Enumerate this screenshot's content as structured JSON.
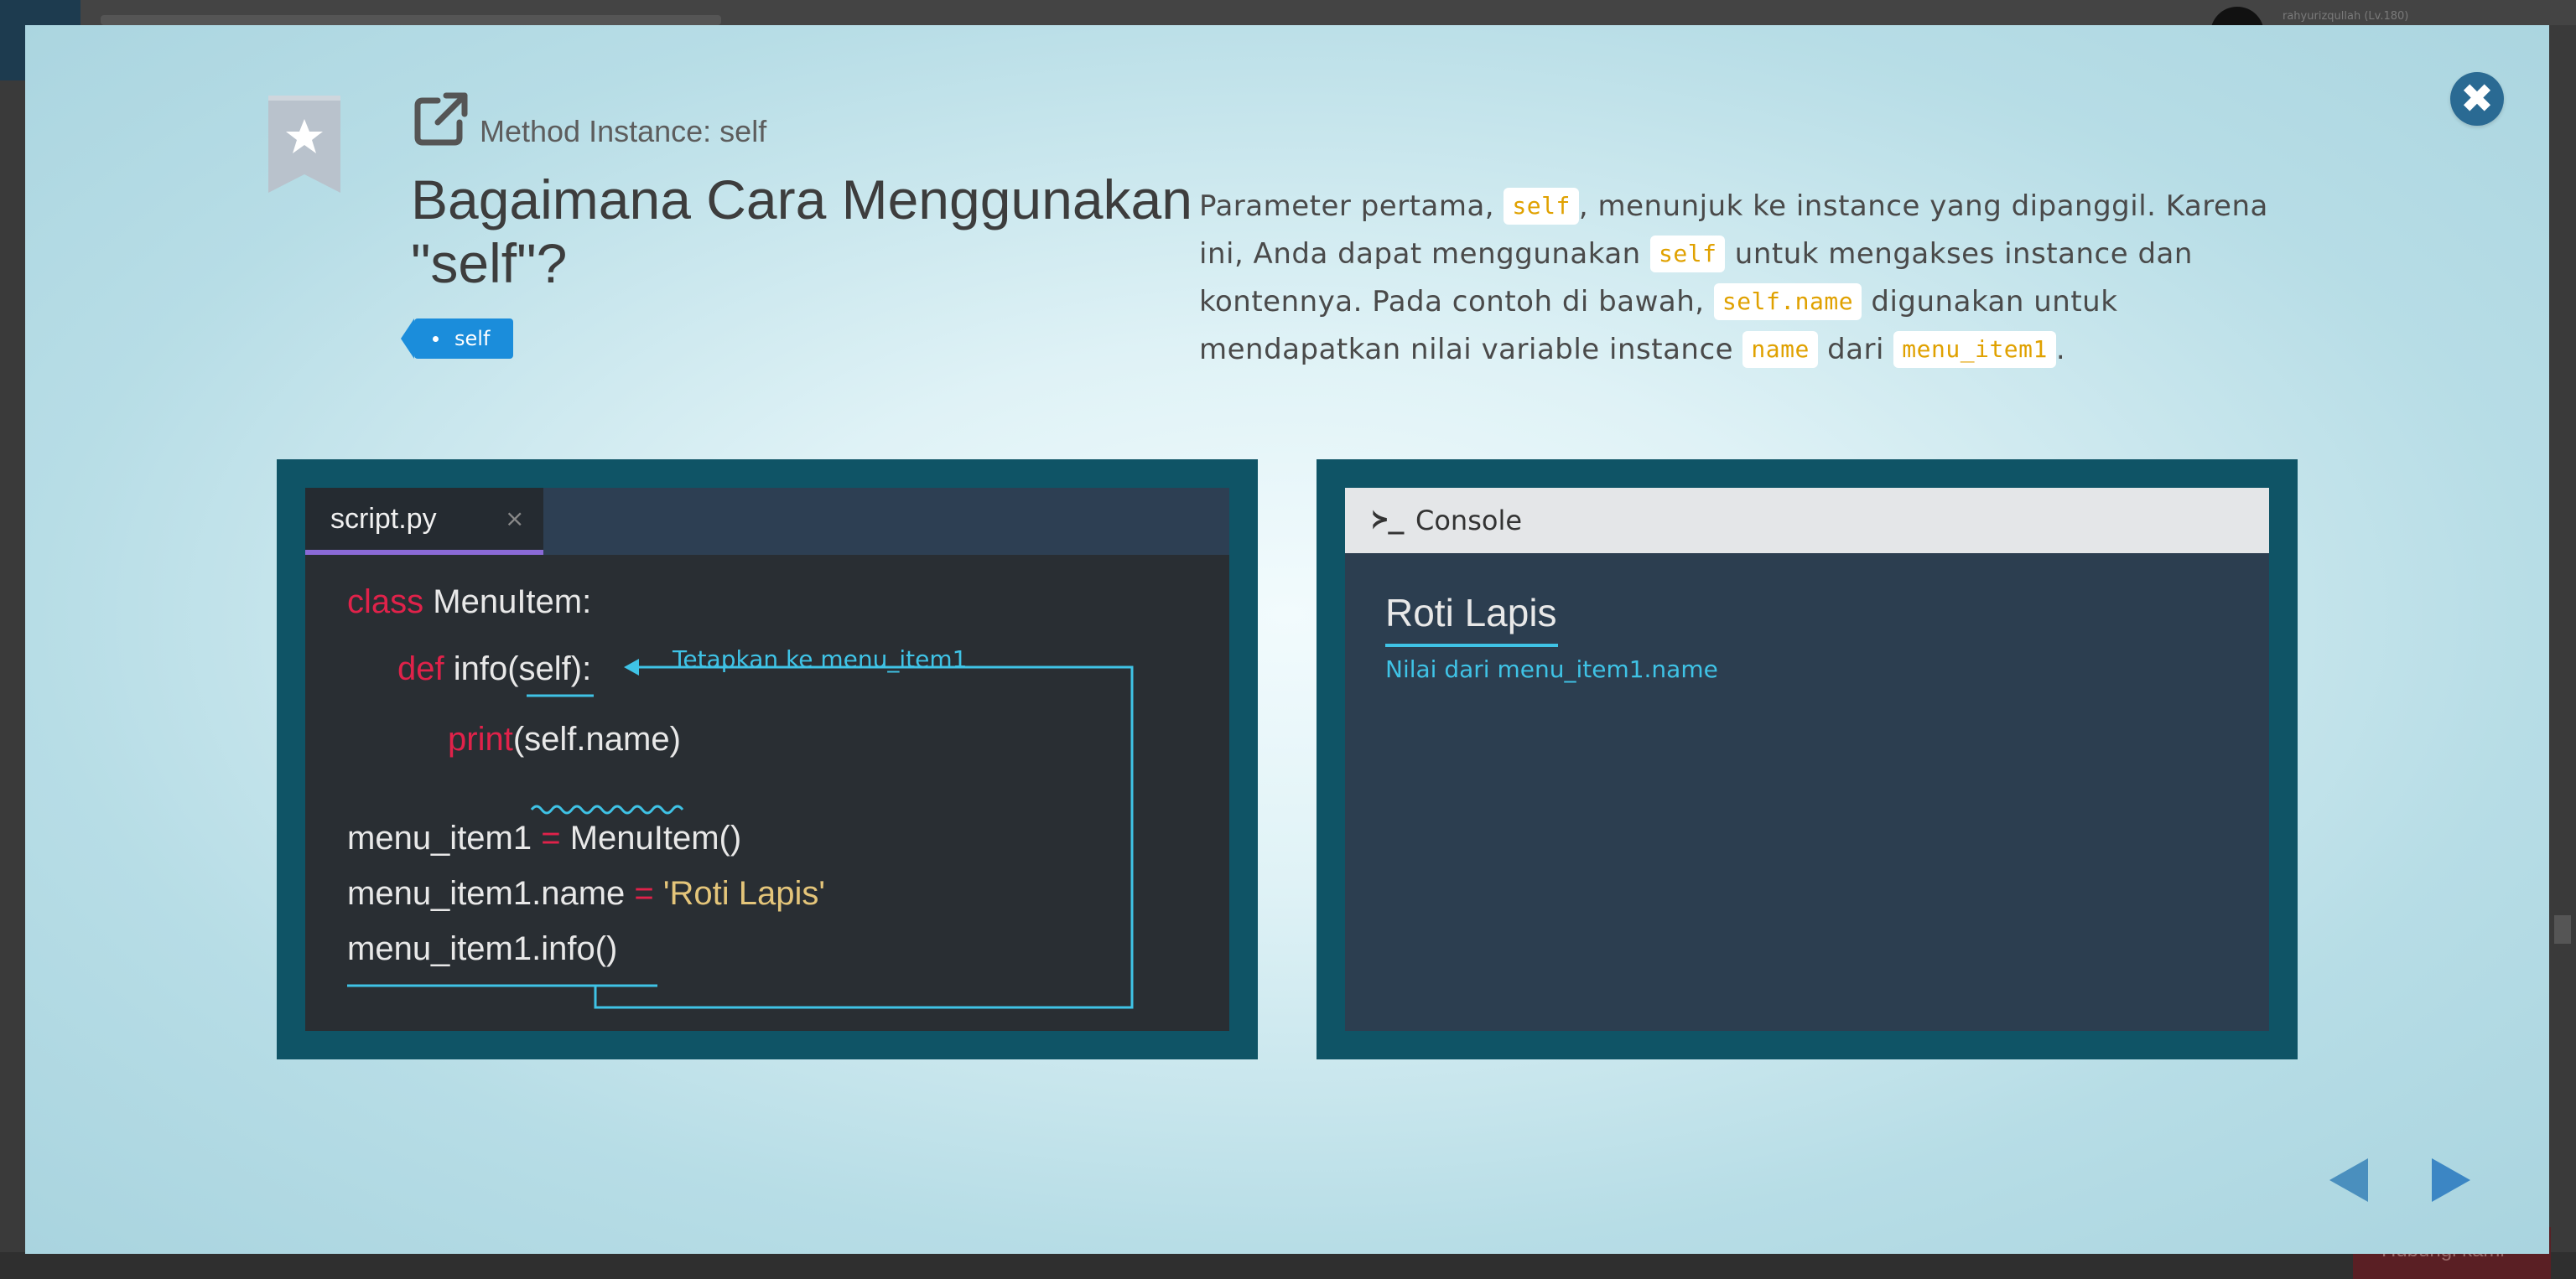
{
  "background_app": {
    "username": "rahyurizqullah (Lv.180)",
    "bottom_button": "Hubungi kami"
  },
  "modal": {
    "close_icon": "close-circle-icon",
    "bookmark_icon": "star-bookmark-icon",
    "external_link_icon": "external-link-icon",
    "subtitle": "Method Instance: self",
    "title_line1": "Bagaimana Cara Menggunakan",
    "title_line2": "\"self\"?",
    "tag": "self",
    "description": {
      "p1": "Parameter pertama, ",
      "c1": "self",
      "p2": ", menunjuk ke instance yang dipanggil. Karena ini, Anda dapat menggunakan ",
      "c2": "self",
      "p3": " untuk mengakses instance dan kontennya. Pada contoh di bawah, ",
      "c3": "self.name",
      "p4": " digunakan untuk mendapatkan nilai variable instance ",
      "c4": "name",
      "p5": " dari ",
      "c5": "menu_item1",
      "p6": "."
    },
    "editor": {
      "tab_name": "script.py",
      "tab_close": "×",
      "line1_kw": "class",
      "line1_rest": " MenuItem:",
      "line2_kw": "def",
      "line2_fn": " info(",
      "line2_self": "self",
      "line2_end": "):",
      "line3_kw": "print",
      "line3_open": "(",
      "line3_arg": "self.name",
      "line3_close": ")",
      "line4_a": "menu_item1 ",
      "line4_op": "=",
      "line4_b": " MenuItem()",
      "line5_a": "menu_item1.name ",
      "line5_op": "=",
      "line5_str": " 'Roti Lapis'",
      "line6": "menu_item1.info()",
      "annotation": "Tetapkan ke menu_item1"
    },
    "console": {
      "prompt_icon": "terminal-prompt-icon",
      "prompt_glyph": "≻_",
      "label": "Console",
      "output": "Roti Lapis",
      "annotation": "Nilai dari menu_item1.name"
    },
    "nav": {
      "prev_icon": "arrow-left-icon",
      "next_icon": "arrow-right-icon"
    },
    "colors": {
      "panel_border": "#0f5466",
      "tag_blue": "#1b8ddb",
      "close_blue": "#2a6a93",
      "keyword_red": "#e0224a",
      "string_yellow": "#e4c57a",
      "annotation_cyan": "#3fc3e6",
      "code_chip_text": "#e0a100"
    }
  }
}
